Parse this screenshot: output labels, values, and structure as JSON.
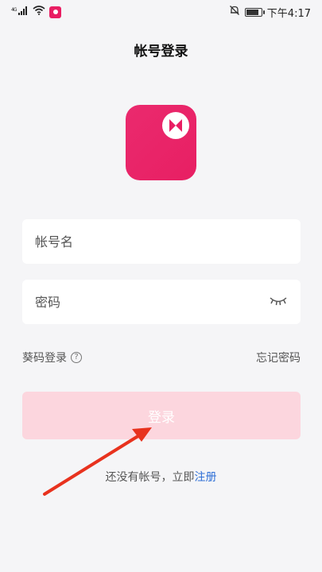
{
  "status_bar": {
    "signal_text": "⁴ᴳ",
    "time": "下午4:17"
  },
  "page": {
    "title": "帐号登录"
  },
  "form": {
    "account_placeholder": "帐号名",
    "password_placeholder": "密码",
    "sms_login_label": "葵码登录",
    "forgot_password_label": "忘记密码",
    "login_button_label": "登录"
  },
  "footer": {
    "no_account_text": "还没有帐号，立即",
    "register_link": "注册"
  },
  "colors": {
    "brand": "#e91e63",
    "button_disabled": "#fcd6de",
    "link": "#2e6fd6",
    "annotation_arrow": "#e8321e"
  }
}
